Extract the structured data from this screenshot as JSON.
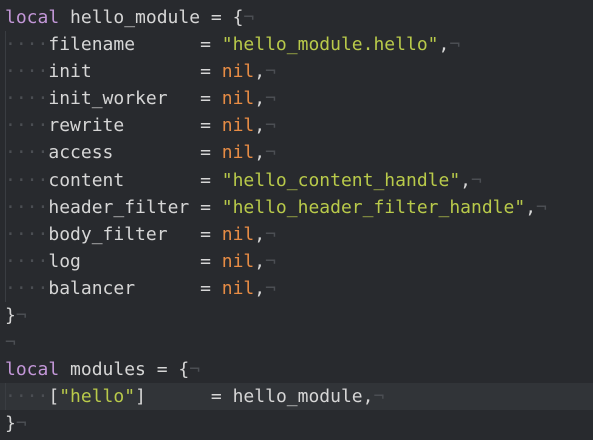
{
  "editor": {
    "lines": [
      [
        {
          "t": "local",
          "c": "kw"
        },
        {
          "t": " hello_module = {",
          "c": "plain"
        },
        {
          "t": "¬",
          "c": "nl"
        }
      ],
      [
        {
          "t": "····",
          "c": "ws"
        },
        {
          "t": "filename      = ",
          "c": "plain"
        },
        {
          "t": "\"hello_module.hello\"",
          "c": "str"
        },
        {
          "t": ",",
          "c": "plain"
        },
        {
          "t": "¬",
          "c": "nl"
        }
      ],
      [
        {
          "t": "····",
          "c": "ws"
        },
        {
          "t": "init          = ",
          "c": "plain"
        },
        {
          "t": "nil",
          "c": "nil"
        },
        {
          "t": ",",
          "c": "plain"
        },
        {
          "t": "¬",
          "c": "nl"
        }
      ],
      [
        {
          "t": "····",
          "c": "ws"
        },
        {
          "t": "init_worker   = ",
          "c": "plain"
        },
        {
          "t": "nil",
          "c": "nil"
        },
        {
          "t": ",",
          "c": "plain"
        },
        {
          "t": "¬",
          "c": "nl"
        }
      ],
      [
        {
          "t": "····",
          "c": "ws"
        },
        {
          "t": "rewrite       = ",
          "c": "plain"
        },
        {
          "t": "nil",
          "c": "nil"
        },
        {
          "t": ",",
          "c": "plain"
        },
        {
          "t": "¬",
          "c": "nl"
        }
      ],
      [
        {
          "t": "····",
          "c": "ws"
        },
        {
          "t": "access        = ",
          "c": "plain"
        },
        {
          "t": "nil",
          "c": "nil"
        },
        {
          "t": ",",
          "c": "plain"
        },
        {
          "t": "¬",
          "c": "nl"
        }
      ],
      [
        {
          "t": "····",
          "c": "ws"
        },
        {
          "t": "content       = ",
          "c": "plain"
        },
        {
          "t": "\"hello_content_handle\"",
          "c": "str"
        },
        {
          "t": ",",
          "c": "plain"
        },
        {
          "t": "¬",
          "c": "nl"
        }
      ],
      [
        {
          "t": "····",
          "c": "ws"
        },
        {
          "t": "header_filter = ",
          "c": "plain"
        },
        {
          "t": "\"hello_header_filter_handle\"",
          "c": "str"
        },
        {
          "t": ",",
          "c": "plain"
        },
        {
          "t": "¬",
          "c": "nl"
        }
      ],
      [
        {
          "t": "····",
          "c": "ws"
        },
        {
          "t": "body_filter   = ",
          "c": "plain"
        },
        {
          "t": "nil",
          "c": "nil"
        },
        {
          "t": ",",
          "c": "plain"
        },
        {
          "t": "¬",
          "c": "nl"
        }
      ],
      [
        {
          "t": "····",
          "c": "ws"
        },
        {
          "t": "log           = ",
          "c": "plain"
        },
        {
          "t": "nil",
          "c": "nil"
        },
        {
          "t": ",",
          "c": "plain"
        },
        {
          "t": "¬",
          "c": "nl"
        }
      ],
      [
        {
          "t": "····",
          "c": "ws"
        },
        {
          "t": "balancer      = ",
          "c": "plain"
        },
        {
          "t": "nil",
          "c": "nil"
        },
        {
          "t": ",",
          "c": "plain"
        },
        {
          "t": "¬",
          "c": "nl"
        }
      ],
      [
        {
          "t": "}",
          "c": "plain"
        },
        {
          "t": "¬",
          "c": "nl"
        }
      ],
      [
        {
          "t": "¬",
          "c": "nl"
        }
      ],
      [
        {
          "t": "local",
          "c": "kw"
        },
        {
          "t": " modules = {",
          "c": "plain"
        },
        {
          "t": "¬",
          "c": "nl"
        }
      ],
      [
        {
          "t": "····",
          "c": "ws"
        },
        {
          "t": "[",
          "c": "plain"
        },
        {
          "t": "\"hello\"",
          "c": "str"
        },
        {
          "t": "]      = hello_module,",
          "c": "plain"
        },
        {
          "t": "¬",
          "c": "nl"
        }
      ],
      [
        {
          "t": "}",
          "c": "plain"
        },
        {
          "t": "¬",
          "c": "nl"
        }
      ]
    ],
    "current_line": 14,
    "colors": {
      "background": "#282a2e",
      "keyword": "#c397d8",
      "string": "#b9ca4a",
      "nil": "#e78c45",
      "whitespace_marker": "#4b4e53",
      "text": "#d6d6d6",
      "current_line": "#313438"
    }
  }
}
